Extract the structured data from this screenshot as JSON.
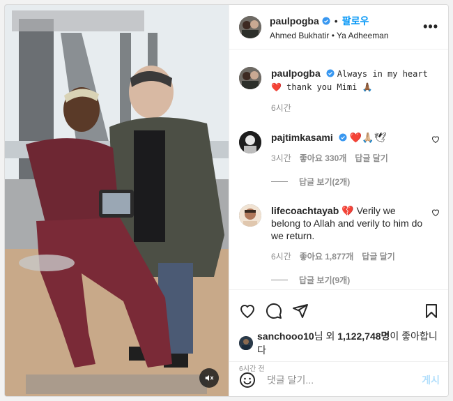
{
  "post": {
    "author": {
      "username": "paulpogba",
      "follow_label": "팔로우",
      "audio": "Ahmed Bukhatir • Ya Adheeman"
    },
    "caption": {
      "username": "paulpogba",
      "text": "Always in my heart ❤️ thank you Mimi 🙏🏾",
      "time": "6시간"
    },
    "comments": [
      {
        "username": "pajtimkasami",
        "text": "❤️🙏🏼🕊",
        "time": "3시간",
        "likes": "좋아요 330개",
        "reply_label": "답글 달기",
        "view_replies": "답글 보기(2개)"
      },
      {
        "username": "lifecoachtayab",
        "text": "💔 Verily we belong to Allah and verily to him do we return.",
        "time": "6시간",
        "likes": "좋아요 1,877개",
        "reply_label": "답글 달기",
        "view_replies": "답글 보기(9개)"
      }
    ],
    "likes_line": {
      "liker": "sanchooo10",
      "middle": "님 외 ",
      "count": "1,122,748명",
      "suffix": "이 좋아합니다"
    },
    "posted_ago": "6시간 전",
    "add_comment": {
      "placeholder": "댓글 달기...",
      "post_label": "게시"
    }
  },
  "colors": {
    "accent": "#0095f6",
    "verified": "#3897f0",
    "muted": "#8e8e8e",
    "post_disabled": "#b2dffc"
  },
  "icons": [
    "verified-badge-icon",
    "more-options-icon",
    "heart-icon",
    "comment-icon",
    "share-icon",
    "bookmark-icon",
    "emoji-icon",
    "mute-icon"
  ]
}
